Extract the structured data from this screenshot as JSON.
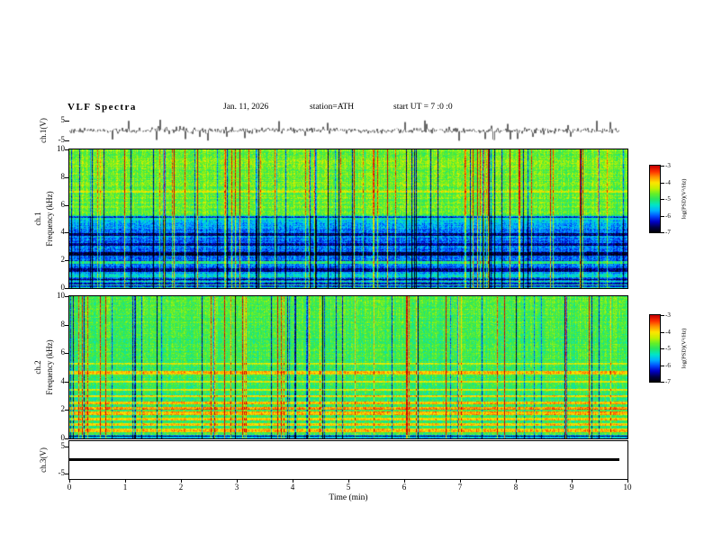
{
  "header": {
    "title": "VLF Spectra",
    "date": "Jan. 11, 2026",
    "station": "station=ATH",
    "start_ut": "start UT =  7 :0 :0"
  },
  "xaxis": {
    "label": "Time (min)",
    "min": 0,
    "max": 10,
    "ticks": [
      0,
      1,
      2,
      3,
      4,
      5,
      6,
      7,
      8,
      9,
      10
    ]
  },
  "colors": {
    "background": "#ffffff",
    "frame": "#000000",
    "trace": "#000000"
  },
  "colormap": [
    "#000000",
    "#00004a",
    "#0000c8",
    "#0050ff",
    "#00b4ff",
    "#00e6c8",
    "#28e664",
    "#64f028",
    "#c8f000",
    "#ffe600",
    "#ff9600",
    "#ff3200",
    "#c80000"
  ],
  "chart_data": [
    {
      "type": "line",
      "name": "ch1-waveform",
      "ylabel": "ch.1(V)",
      "ylim": [
        -7,
        7
      ],
      "yticks": [
        5,
        -5
      ],
      "x_range_min": [
        0,
        9.85
      ],
      "description": "Zero-mean broadband noise voltage trace, RMS ~1.5 V, frequent spikes to about ±5 V over the full 0-10 min record.",
      "render": {
        "seed": 1234567,
        "noise_amp": 1.15,
        "spike_prob": 0.05,
        "spike_amp": 3.2
      }
    },
    {
      "type": "heatmap",
      "name": "ch1-spectrogram",
      "ylabel_channel": "ch.1",
      "ylabel_axis": "Frequency (kHz)",
      "ylim": [
        0,
        10
      ],
      "yticks": [
        0,
        2,
        4,
        6,
        8,
        10
      ],
      "x_range_min": [
        0,
        10
      ],
      "colorbar": {
        "label": "log(PSD)(V²/Hz)",
        "zlim": [
          -7,
          -3
        ],
        "ticks": [
          -3,
          -4,
          -5,
          -6,
          -7
        ]
      },
      "description": "Above ~5 kHz strong broadband power (green-yellow, log PSD ~ -4) cut by many narrow vertical bursts reaching red (-3) and occasional dark dropouts; 1-5 kHz weaker power (blue-cyan, -6 to -5) with faint horizontal bands; below ~1 kHz alternating near-black and green horizontal bands.",
      "render": {
        "seed": 20260111,
        "base_profile": [
          [
            0,
            0.05
          ],
          [
            0.08,
            0.5
          ],
          [
            0.16,
            0.05
          ],
          [
            0.26,
            0.52
          ],
          [
            0.36,
            0.06
          ],
          [
            0.5,
            0.5
          ],
          [
            0.65,
            0.08
          ],
          [
            0.85,
            0.45
          ],
          [
            1.1,
            0.32
          ],
          [
            1.6,
            0.28
          ],
          [
            2.2,
            0.26
          ],
          [
            3.0,
            0.27
          ],
          [
            4.2,
            0.3
          ],
          [
            4.9,
            0.38
          ],
          [
            5.3,
            0.56
          ],
          [
            6.0,
            0.58
          ],
          [
            10,
            0.6
          ]
        ],
        "h_lines": [
          {
            "f": 1.35,
            "w": 0.12,
            "boost": -0.18
          },
          {
            "f": 1.9,
            "w": 0.1,
            "boost": 0.22
          },
          {
            "f": 2.5,
            "w": 0.12,
            "boost": -0.2
          },
          {
            "f": 3.2,
            "w": 0.1,
            "boost": -0.15
          },
          {
            "f": 3.9,
            "w": 0.1,
            "boost": -0.18
          },
          {
            "f": 5.15,
            "w": 0.08,
            "boost": -0.25
          },
          {
            "f": 7.0,
            "w": 0.06,
            "boost": 0.1
          }
        ],
        "red_streak_prob": 0.07,
        "dark_streak_prob": 0.06,
        "row_jitter": 0.08,
        "pixel_noise": 0.16
      }
    },
    {
      "type": "heatmap",
      "name": "ch2-spectrogram",
      "ylabel_channel": "ch.2",
      "ylabel_axis": "Frequency (kHz)",
      "ylim": [
        0,
        10
      ],
      "yticks": [
        0,
        2,
        4,
        6,
        8,
        10
      ],
      "x_range_min": [
        0,
        10
      ],
      "colorbar": {
        "label": "log(PSD)(V²/Hz)",
        "zlim": [
          -7,
          -3
        ],
        "ticks": [
          -3,
          -4,
          -5,
          -6,
          -7
        ]
      },
      "description": "Nearly uniform green background (log PSD ~ -4.5) with dense vertical burst striations (yellow-red and dark); bright yellow-red horizontal interference lines between ~0.5 and 5 kHz; thin dark bands at the lowest frequencies.",
      "render": {
        "seed": 987654,
        "base_profile": [
          [
            0,
            0.06
          ],
          [
            0.1,
            0.5
          ],
          [
            0.2,
            0.08
          ],
          [
            0.3,
            0.55
          ],
          [
            0.45,
            0.5
          ],
          [
            1.0,
            0.5
          ],
          [
            2.0,
            0.5
          ],
          [
            5.0,
            0.52
          ],
          [
            10,
            0.55
          ]
        ],
        "h_lines": [
          {
            "f": 0.6,
            "w": 0.1,
            "boost": 0.3
          },
          {
            "f": 1.0,
            "w": 0.08,
            "boost": 0.28
          },
          {
            "f": 1.4,
            "w": 0.08,
            "boost": 0.25
          },
          {
            "f": 1.8,
            "w": 0.1,
            "boost": 0.3
          },
          {
            "f": 2.15,
            "w": 0.12,
            "boost": 0.35
          },
          {
            "f": 2.55,
            "w": 0.1,
            "boost": 0.3
          },
          {
            "f": 3.0,
            "w": 0.08,
            "boost": 0.25
          },
          {
            "f": 3.45,
            "w": 0.08,
            "boost": 0.22
          },
          {
            "f": 4.0,
            "w": 0.06,
            "boost": 0.2
          },
          {
            "f": 4.65,
            "w": 0.1,
            "boost": 0.28
          },
          {
            "f": 5.3,
            "w": 0.05,
            "boost": 0.15
          }
        ],
        "red_streak_prob": 0.06,
        "dark_streak_prob": 0.05,
        "row_jitter": 0.07,
        "pixel_noise": 0.15
      }
    },
    {
      "type": "line",
      "name": "ch3-waveform",
      "ylabel": "ch.3(V)",
      "ylim": [
        -7,
        7
      ],
      "yticks": [
        5,
        -5
      ],
      "x_range_min": [
        0,
        9.85
      ],
      "constant_value": 0,
      "description": "Channel 3 voltage is flat at ~0 V for the whole record (thick constant black trace)."
    }
  ]
}
